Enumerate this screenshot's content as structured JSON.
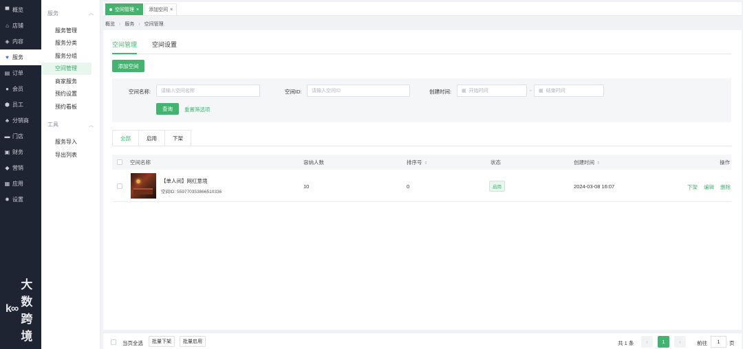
{
  "sidebar": {
    "items": [
      {
        "icon": "monitor-icon",
        "glyph": "▀",
        "label": "概览"
      },
      {
        "icon": "shop-icon",
        "glyph": "⌂",
        "label": "店铺"
      },
      {
        "icon": "layers-icon",
        "glyph": "◈",
        "label": "内容"
      },
      {
        "icon": "heart-icon",
        "glyph": "♥",
        "label": "服务"
      },
      {
        "icon": "order-icon",
        "glyph": "▤",
        "label": "订单"
      },
      {
        "icon": "user-icon",
        "glyph": "●",
        "label": "会员"
      },
      {
        "icon": "staff-icon",
        "glyph": "⬢",
        "label": "员工"
      },
      {
        "icon": "network-icon",
        "glyph": "♣",
        "label": "分销商"
      },
      {
        "icon": "store-icon",
        "glyph": "▬",
        "label": "门店"
      },
      {
        "icon": "wallet-icon",
        "glyph": "▣",
        "label": "财务"
      },
      {
        "icon": "tag-icon",
        "glyph": "◆",
        "label": "营销"
      },
      {
        "icon": "apps-icon",
        "glyph": "▦",
        "label": "应用"
      },
      {
        "icon": "gear-icon",
        "glyph": "✹",
        "label": "设置"
      }
    ],
    "active_index": 3,
    "logo_text": "大数跨境"
  },
  "submenu": {
    "group1_title": "服务",
    "group1_items": [
      "服务管理",
      "服务分类",
      "服务分组",
      "空间管理",
      "商家服务",
      "预约设置",
      "预约看板"
    ],
    "active_item": "空间管理",
    "group2_title": "工具",
    "group2_items": [
      "服务导入",
      "导出列表"
    ]
  },
  "page_tabs": [
    {
      "label": "空间管理",
      "close": "×",
      "active": true
    },
    {
      "label": "添加空间",
      "close": "×",
      "active": false
    }
  ],
  "breadcrumb": [
    "概览",
    "服务",
    "空间管理"
  ],
  "content_tabs": [
    "空间管理",
    "空间设置"
  ],
  "add_button": "添加空间",
  "filter": {
    "name_label": "空间名称:",
    "name_placeholder": "请输入空间名称",
    "id_label": "空间ID:",
    "id_placeholder": "请输入空间ID",
    "time_label": "创建时间:",
    "start_placeholder": "开始时间",
    "end_placeholder": "结束时间",
    "dash": "-",
    "query_button": "查询",
    "reset_link": "重置筛选项"
  },
  "status_tabs": [
    "全部",
    "启用",
    "下架"
  ],
  "table": {
    "headers": {
      "name": "空间名称",
      "capacity": "容纳人数",
      "sort": "排序号",
      "status": "状态",
      "created": "创建时间",
      "actions": "操作"
    },
    "rows": [
      {
        "name": "【单人间】网红意境",
        "id": "空间ID: 559770353866510336",
        "capacity": "10",
        "sort": "0",
        "status": "启用",
        "created": "2024-03-08 16:07",
        "actions": [
          "下架",
          "编辑",
          "删除"
        ]
      }
    ]
  },
  "footer": {
    "select_all": "当页全选",
    "batch_off": "批量下架",
    "batch_on": "批量启用",
    "total": "共 1 条",
    "current_page": "1",
    "goto_label": "前往",
    "goto_value": "1",
    "page_suffix": "页"
  },
  "colors": {
    "accent": "#42b46f",
    "sidebar_bg": "#1f2433"
  }
}
